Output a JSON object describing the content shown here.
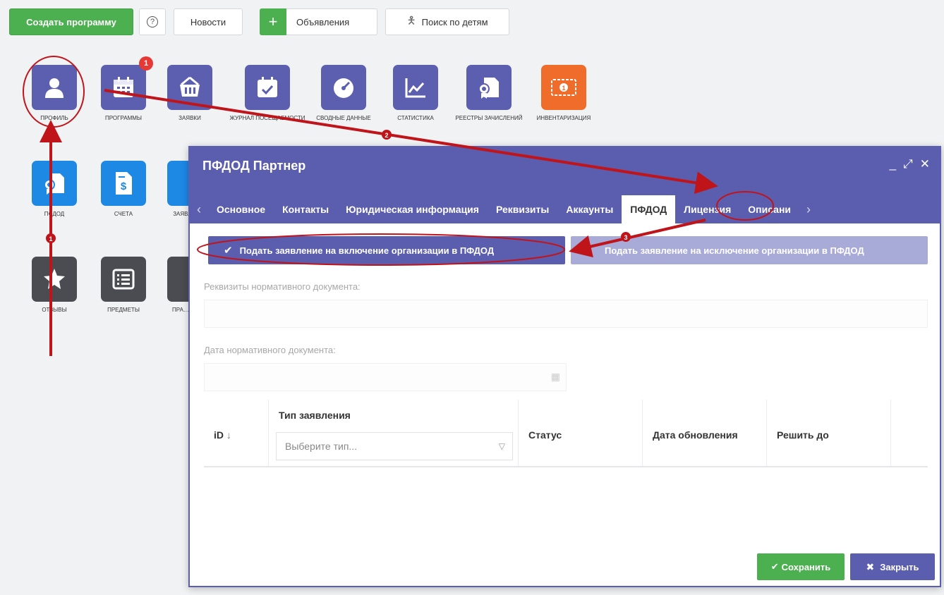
{
  "toolbar": {
    "create_program": "Создать программу",
    "help": "?",
    "news": "Новости",
    "ads_plus": "+",
    "ads": "Объявления",
    "kids_search": "Поиск по детям"
  },
  "tiles": [
    {
      "label": "Профиль",
      "icon": "person-icon",
      "glyph": "👤"
    },
    {
      "label": "Программы",
      "icon": "calendar-icon",
      "glyph": "▦",
      "badge": "1"
    },
    {
      "label": "Заявки",
      "icon": "basket-icon",
      "glyph": "⌂"
    },
    {
      "label": "Журнал посещаемости",
      "icon": "calendar-check-icon",
      "glyph": "✔"
    },
    {
      "label": "Сводные данные",
      "icon": "gauge-icon",
      "glyph": "◔"
    },
    {
      "label": "Статистика",
      "icon": "chart-icon",
      "glyph": "〽"
    },
    {
      "label": "Реестры зачислений",
      "icon": "document-award-icon",
      "glyph": "❏"
    },
    {
      "label": "Инвентаризация",
      "icon": "money-icon",
      "glyph": "⊙"
    },
    {
      "label": "ПФДОД",
      "icon": "certificate-icon",
      "glyph": "❏"
    },
    {
      "label": "Счета",
      "icon": "invoice-icon",
      "glyph": "$"
    },
    {
      "label": "Заявл. НОК",
      "icon": "hand-icon",
      "glyph": "✋"
    },
    {
      "label": "Отзывы",
      "icon": "star-icon",
      "glyph": "★"
    },
    {
      "label": "Предметы",
      "icon": "list-icon",
      "glyph": "☰"
    },
    {
      "label": "Пра… кан…",
      "icon": "person-stand-icon",
      "glyph": "♙"
    }
  ],
  "dialog": {
    "title": "ПФДОД Партнер",
    "controls": {
      "minimize": "_",
      "expand": "⤢",
      "close": "✕"
    },
    "tabs": [
      "Основное",
      "Контакты",
      "Юридическая информация",
      "Реквизиты",
      "Аккаунты",
      "ПФДОД",
      "Лицензия",
      "Описани"
    ],
    "active_tab": "ПФДОД",
    "include_button": "Подать заявление на включение организации в ПФДОД",
    "exclude_button": "Подать заявление на исключение организации в ПФДОД",
    "doc_requisites_label": "Реквизиты нормативного документа:",
    "doc_date_label": "Дата нормативного документа:",
    "table": {
      "columns": [
        "iD",
        "Тип заявления",
        "Статус",
        "Дата обновления",
        "Решить до"
      ],
      "type_placeholder": "Выберите тип..."
    },
    "save_button": "Сохранить",
    "close_button": "Закрыть"
  },
  "annotations": {
    "step1": "1",
    "step2": "2",
    "step3": "3"
  },
  "colors": {
    "accent": "#5b5dae",
    "green": "#4caf50",
    "annotation_red": "#c0141b"
  }
}
